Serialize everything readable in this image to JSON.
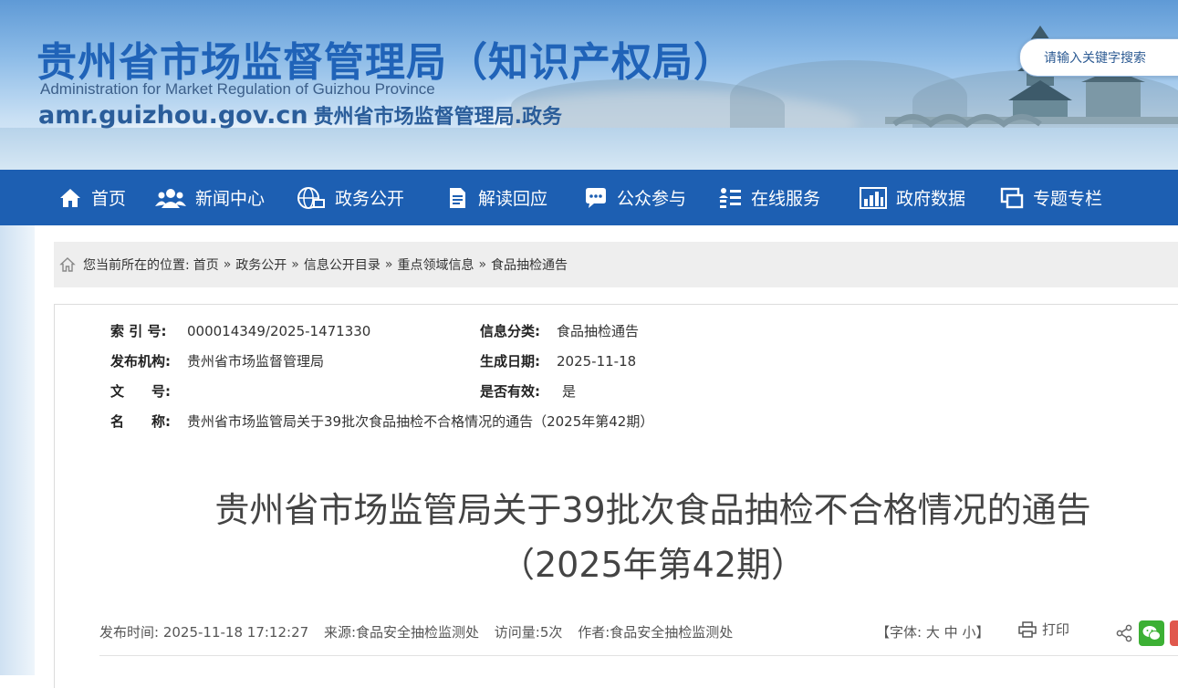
{
  "header": {
    "title": "贵州省市场监督管理局（知识产权局）",
    "subtitle": "Administration for Market Regulation of Guizhou Province",
    "domain": "amr.guizhou.gov.cn",
    "domain_suffix": "贵州省市场监督管理局.政务",
    "search_placeholder": "请输入关键字搜索"
  },
  "nav": {
    "items": [
      {
        "label": "首页",
        "icon": "home-icon"
      },
      {
        "label": "新闻中心",
        "icon": "people-icon"
      },
      {
        "label": "政务公开",
        "icon": "globe-icon"
      },
      {
        "label": "解读回应",
        "icon": "document-icon"
      },
      {
        "label": "公众参与",
        "icon": "chat-icon"
      },
      {
        "label": "在线服务",
        "icon": "list-icon"
      },
      {
        "label": "政府数据",
        "icon": "bar-chart-icon"
      },
      {
        "label": "专题专栏",
        "icon": "windows-icon"
      }
    ]
  },
  "breadcrumb": {
    "prefix": "您当前所在的位置:",
    "items": [
      "首页",
      "政务公开",
      "信息公开目录",
      "重点领域信息",
      "食品抽检通告"
    ],
    "separator": "»"
  },
  "meta": {
    "index_label": "索 引 号:",
    "index_value": "000014349/2025-1471330",
    "category_label": "信息分类:",
    "category_value": "食品抽检通告",
    "publisher_label": "发布机构:",
    "publisher_value": "贵州省市场监督管理局",
    "date_label": "生成日期:",
    "date_value": "2025-11-18",
    "docno_label": "文　　号:",
    "docno_value": "",
    "valid_label": "是否有效:",
    "valid_value": "是",
    "name_label": "名　　称:",
    "name_value": "贵州省市场监管局关于39批次食品抽检不合格情况的通告（2025年第42期）"
  },
  "article": {
    "title_line1": "贵州省市场监管局关于39批次食品抽检不合格情况的通告",
    "title_line2": "（2025年第42期）"
  },
  "info": {
    "publish_time_label": "发布时间:",
    "publish_time": "2025-11-18 17:12:27",
    "source_label": "来源:",
    "source": "食品安全抽检监测处",
    "views_label": "访问量:",
    "views": "5次",
    "author_label": "作者:",
    "author": "食品安全抽检监测处",
    "font_label_open": "【字体:",
    "font_large": "大",
    "font_medium": "中",
    "font_small": "小",
    "font_label_close": "】",
    "print_label": "打印"
  },
  "colors": {
    "nav_bg": "#1d5fb2",
    "title_blue": "#2063b8",
    "wechat_green": "#3cb034"
  }
}
